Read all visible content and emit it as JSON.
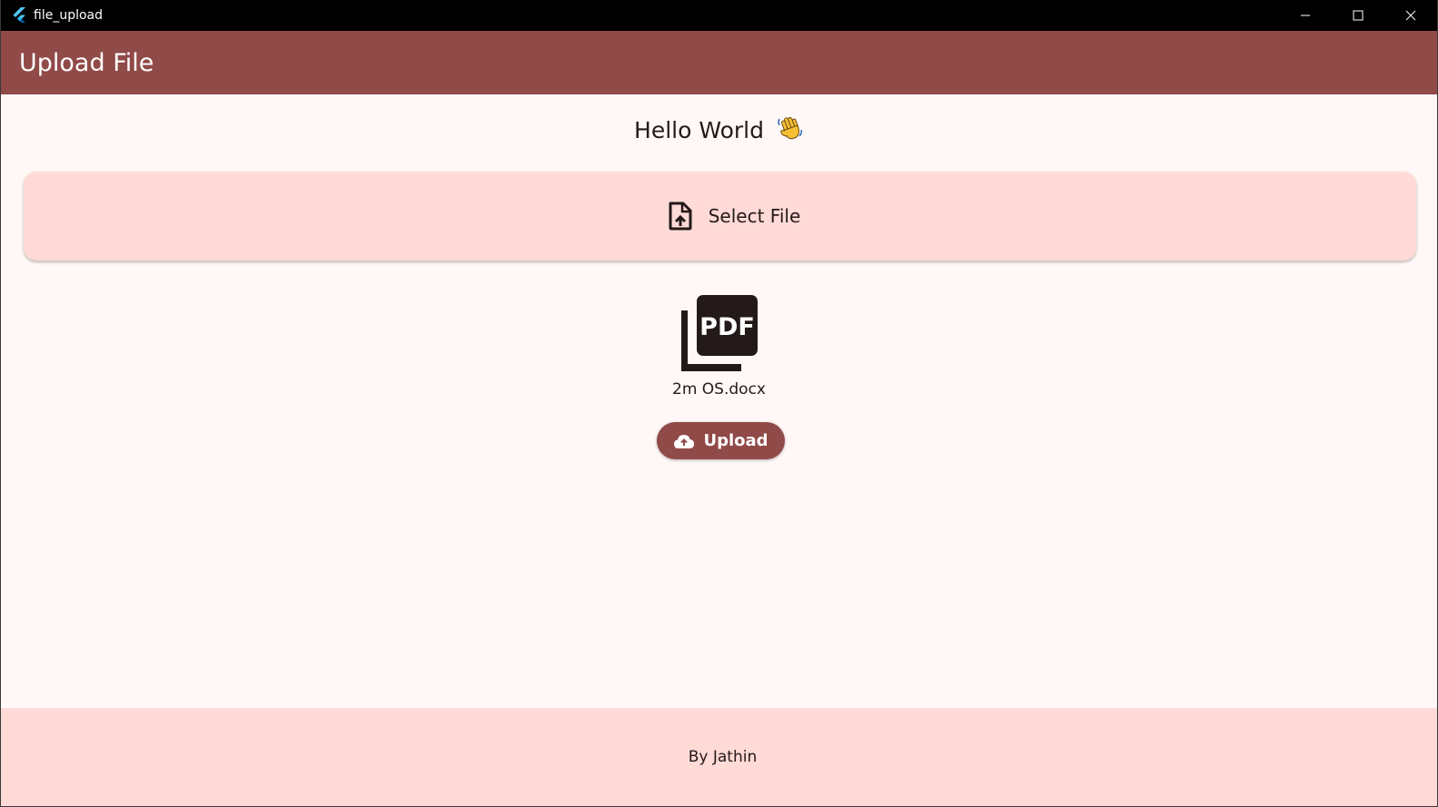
{
  "window": {
    "title": "file_upload",
    "app_icon": "flutter-logo-icon",
    "controls": [
      "minimize-icon",
      "maximize-icon",
      "close-icon"
    ]
  },
  "appbar": {
    "title": "Upload File"
  },
  "main": {
    "greeting": "Hello World",
    "greeting_emoji": "waving-hand-icon",
    "select_file": {
      "label": "Select File",
      "icon": "file-upload-icon"
    },
    "selected_file": {
      "icon": "picture-as-pdf-icon",
      "name": "2m OS.docx"
    },
    "upload_button": {
      "label": "Upload",
      "icon": "cloud-upload-icon"
    }
  },
  "footer": {
    "text": "By Jathin"
  },
  "colors": {
    "primary": "#904a48",
    "surface": "#fff8f7",
    "container": "#ffdad7",
    "on_surface": "#231918"
  }
}
